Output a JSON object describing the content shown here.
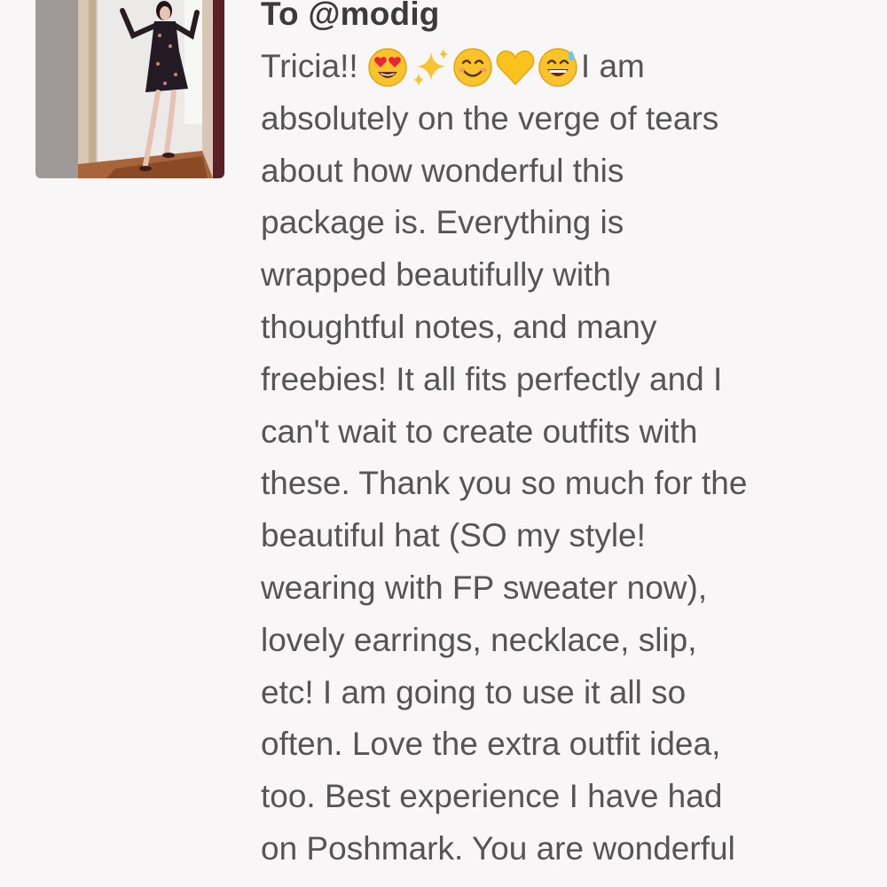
{
  "review": {
    "recipient": "To @modig",
    "photo_alt": "buyer photo wearing dress in doorway",
    "emojis": [
      "heart-eyes-face",
      "sparkles",
      "smiling-face",
      "yellow-heart",
      "grinning-face-with-sweat"
    ],
    "lines": [
      {
        "prefix": "Tricia!!",
        "suffix": "I am"
      },
      {
        "text": "absolutely on the verge of tears"
      },
      {
        "text": "about how wonderful this"
      },
      {
        "text": "package is. Everything is"
      },
      {
        "text": "wrapped beautifully with"
      },
      {
        "text": "thoughtful notes, and many"
      },
      {
        "text": "freebies! It all fits perfectly and I"
      },
      {
        "text": "can't wait to create outfits with"
      },
      {
        "text": "these. Thank you so much for the"
      },
      {
        "text": "beautiful hat (SO my style!"
      },
      {
        "text": "wearing with FP sweater now),"
      },
      {
        "text": "lovely earrings, necklace, slip,"
      },
      {
        "text": "etc! I am going to use it all so"
      },
      {
        "text": "often. Love the extra outfit idea,"
      },
      {
        "text": "too. Best experience I have had"
      },
      {
        "text": "on Poshmark. You are wonderful"
      }
    ]
  },
  "colors": {
    "background": "#f9f6f7",
    "text": "#555555",
    "heading": "#3b3b3b"
  }
}
